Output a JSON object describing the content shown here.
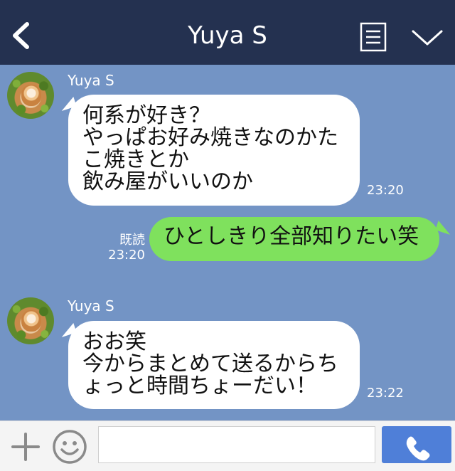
{
  "header": {
    "title": "Yuya S",
    "back_icon": "chevron-left-icon",
    "menu_icon": "notes-menu-icon",
    "expand_icon": "chevron-down-icon"
  },
  "messages": [
    {
      "sender": "Yuya S",
      "text": "何系が好き？\nやっぱお好み焼きなのかた\nこ焼きとか\n飲み屋がいいのか",
      "time": "23:20"
    },
    {
      "text": "ひとしきり全部知りたい笑",
      "read_label": "既読",
      "time": "23:20"
    },
    {
      "sender": "Yuya S",
      "text": "おお笑\n今からまとめて送るからち\nょっと時間ちょーだい！",
      "time": "23:22"
    }
  ],
  "input_bar": {
    "placeholder": "",
    "plus_icon": "plus-icon",
    "emoji_icon": "smiley-icon",
    "call_icon": "phone-icon"
  },
  "colors": {
    "header_bg": "#243150",
    "chat_bg": "#7394c5",
    "own_bubble": "#7fe15d",
    "other_bubble": "#ffffff",
    "call_button": "#4f7fd8"
  }
}
